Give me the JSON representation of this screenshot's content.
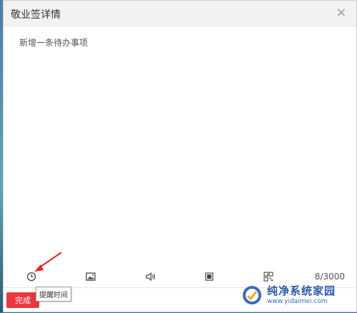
{
  "dialog": {
    "title": "敬业签详情",
    "close_glyph": "×",
    "content": "新增一条待办事项"
  },
  "toolbar": {
    "icons": [
      "clock-icon",
      "image-icon",
      "speaker-icon",
      "stop-icon",
      "qr-code-icon"
    ],
    "counter": "8/3000"
  },
  "footer": {
    "done_label": "完成"
  },
  "tooltip": {
    "text": "提醒时间"
  },
  "annotation": {
    "arrow_color": "#e02a2a"
  },
  "watermark": {
    "title": "纯净系统家园",
    "url": "www.yidaimei.com"
  },
  "colors": {
    "primary": "#e8383d",
    "title_bar": "#f2f2f2",
    "icon": "#444444"
  }
}
